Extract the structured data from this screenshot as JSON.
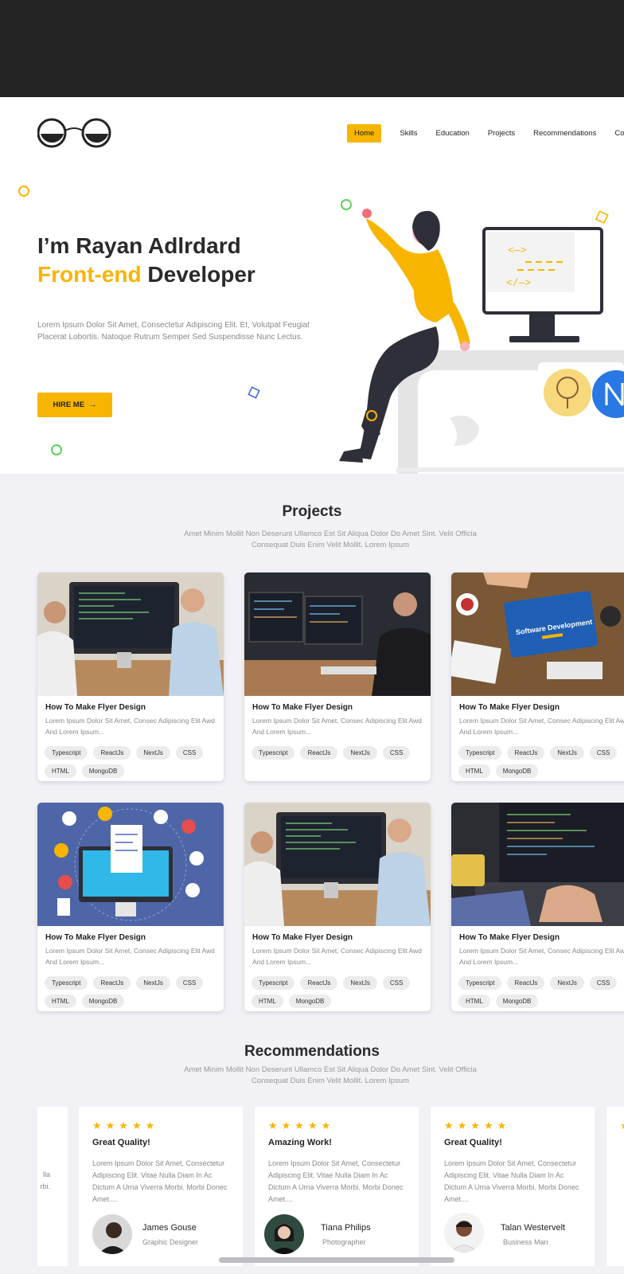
{
  "nav": {
    "items": [
      "Home",
      "Skills",
      "Education",
      "Projects",
      "Recommendations",
      "Con"
    ],
    "active_color": "#f7b500"
  },
  "hero": {
    "line1": "I’m Rayan Adlrdard",
    "accent": "Front-end",
    "line2_rest": " Developer",
    "description": "Lorem Ipsum Dolor Sit Amet, Consectetur Adipiscing Elit. Et, Volutpat Feugiat Placerat Lobortis. Natoque Rutrum Semper Sed Suspendisse Nunc Lectus.",
    "cta_label": "HIRE ME",
    "cta_icon": "arrow-right-icon",
    "code_glyphs": [
      "<—>",
      "</—>"
    ]
  },
  "projects": {
    "title": "Projects",
    "subtitle": "Amet Minim Mollit Non Deserunt Ullamco Est Sit Aliqua Dolor Do Amet Sint. Velit Officia Consequat Duis Enim Velit Mollit. Lorem Ipsum",
    "cards": [
      {
        "title": "How To Make Flyer Design",
        "desc": "Lorem Ipsum Dolor Sit Amet, Consec Adipiscing Elit Awd And Lorem Ipsum...",
        "tags": [
          "Typescript",
          "ReactJs",
          "NextJs",
          "CSS",
          "HTML",
          "MongoDB"
        ]
      },
      {
        "title": "How To Make Flyer Design",
        "desc": "Lorem Ipsum Dolor Sit Amet, Consec Adipiscing Elit Awd And Lorem Ipsum...",
        "tags": [
          "Typescript",
          "ReactJs",
          "NextJs",
          "CSS"
        ]
      },
      {
        "title": "How To Make Flyer Design",
        "desc": "Lorem Ipsum Dolor Sit Amet, Consec Adipiscing Elit Awd And Lorem Ipsum...",
        "tags": [
          "Typescript",
          "ReactJs",
          "NextJs",
          "CSS",
          "HTML",
          "MongoDB"
        ]
      },
      {
        "title": "How To Make Flyer Design",
        "desc": "Lorem Ipsum Dolor Sit Amet, Consec Adipiscing Elit Awd And Lorem Ipsum...",
        "tags": [
          "Typescript",
          "ReactJs",
          "NextJs",
          "CSS",
          "HTML",
          "MongoDB"
        ]
      },
      {
        "title": "How To Make Flyer Design",
        "desc": "Lorem Ipsum Dolor Sit Amet, Consec Adipiscing Elit Awd And Lorem Ipsum...",
        "tags": [
          "Typescript",
          "ReactJs",
          "NextJs",
          "CSS",
          "HTML",
          "MongoDB"
        ]
      },
      {
        "title": "How To Make Flyer Design",
        "desc": "Lorem Ipsum Dolor Sit Amet, Consec Adipiscing Elit Awd And Lorem Ipsum...",
        "tags": [
          "Typescript",
          "ReactJs",
          "NextJs",
          "CSS",
          "HTML",
          "MongoDB"
        ]
      }
    ],
    "image_texts": {
      "software_development": "Software Development"
    }
  },
  "recommendations": {
    "title": "Recommendations",
    "subtitle": "Amet Minim Mollit Non Deserunt Ullamco Est Sit Aliqua Dolor Do Amet Sint. Velit Officia Consequat Duis Enim Velit Mollit. Lorem Ipsum",
    "partial_left_text": [
      "lla",
      "rbi."
    ],
    "cards": [
      {
        "stars": "★★★★★",
        "title": "Great Quality!",
        "text": "Lorem Ipsum Dolor Sit Amet, Consectetur Adipiscing Elit. Vitae Nulla Diam In Ac Dictum A Urna Viverra Morbi. Morbi Donec Amet....",
        "name": "James Gouse",
        "role": "Graphic Designer"
      },
      {
        "stars": "★★★★★",
        "title": "Amazing Work!",
        "text": "Lorem Ipsum Dolor Sit Amet, Consectetur Adipiscing Elit. Vitae Nulla Diam In Ac Dictum A Urna Viverra Morbi. Morbi Donec Amet....",
        "name": "Tiana Philips",
        "role": "Photographer"
      },
      {
        "stars": "★★★★★",
        "title": "Great Quality!",
        "text": "Lorem Ipsum Dolor Sit Amet, Consectetur Adipiscing Elit. Vitae Nulla Diam In Ac Dictum A Urna Viverra Morbi. Morbi Donec Amet....",
        "name": "Talan Westervelt",
        "role": "Business Man"
      }
    ]
  },
  "colors": {
    "accent": "#f7b500",
    "dark": "#232323",
    "bg": "#f1f1f6"
  }
}
